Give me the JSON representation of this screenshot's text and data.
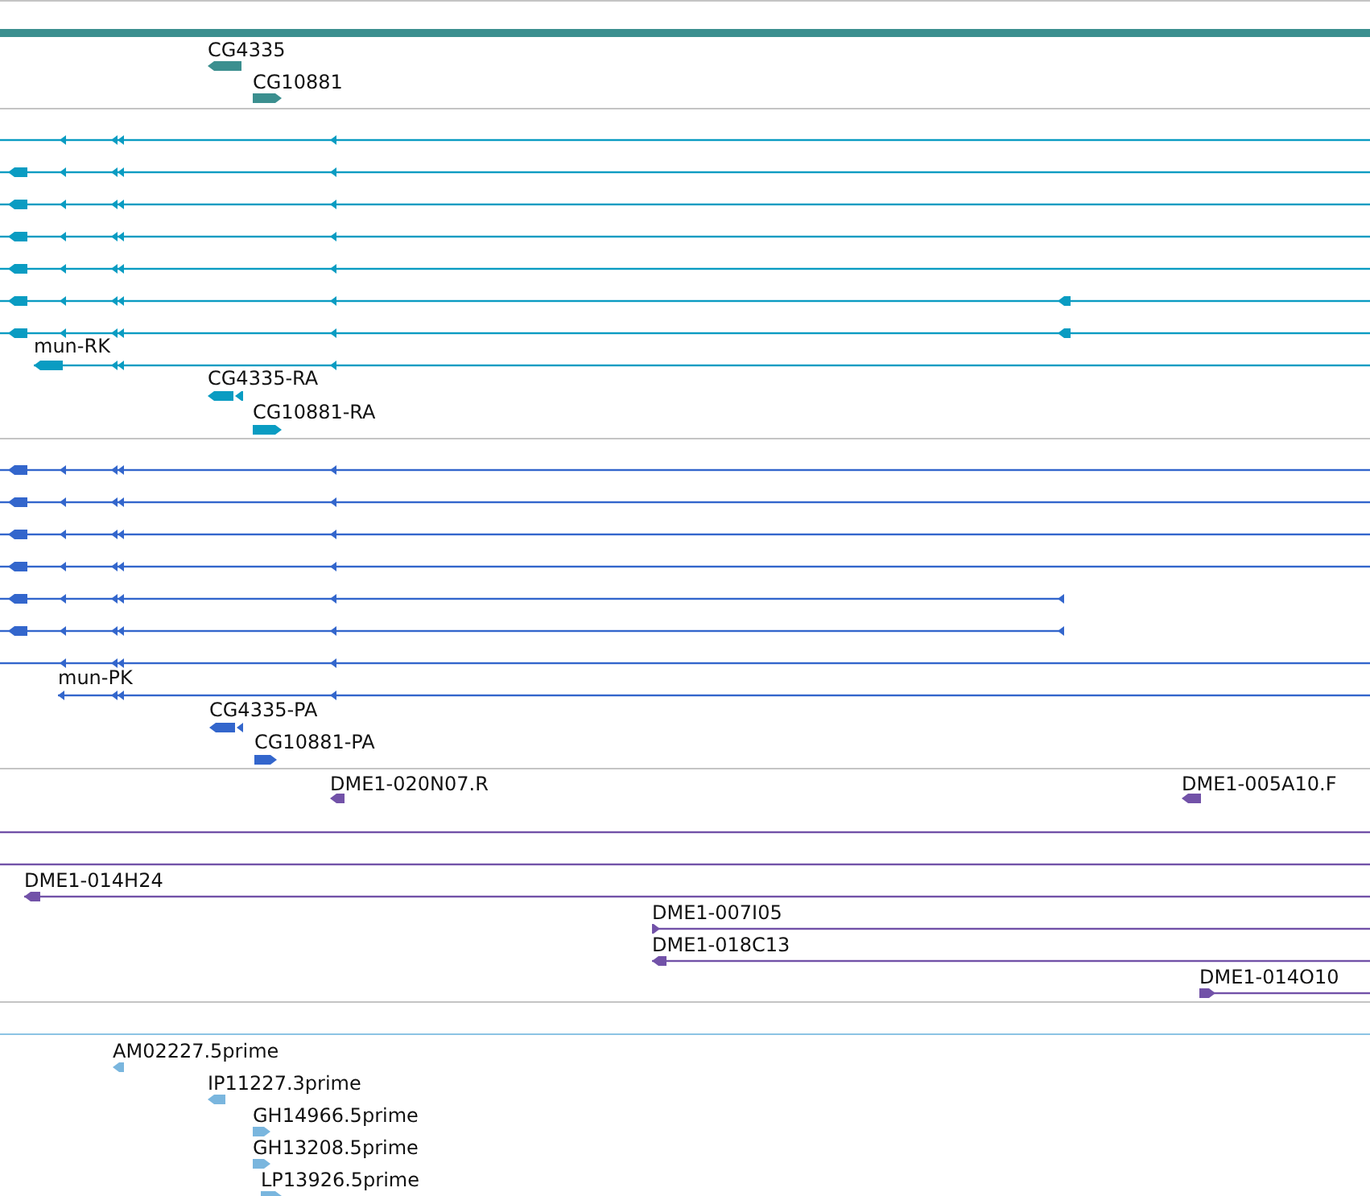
{
  "tracks": [
    {
      "kind": "gene",
      "color": "#3b8f8f",
      "features": [
        {
          "label": "CG4335",
          "kind": "reverse"
        },
        {
          "label": "CG10881",
          "kind": "forward"
        }
      ]
    },
    {
      "kind": "transcript",
      "color": "#0a9cc2",
      "features": [
        {
          "kind": "reverse"
        },
        {
          "kind": "reverse"
        },
        {
          "kind": "reverse"
        },
        {
          "kind": "reverse"
        },
        {
          "kind": "reverse"
        },
        {
          "kind": "reverse"
        },
        {
          "kind": "reverse"
        },
        {
          "label": "mun-RK",
          "kind": "reverse"
        },
        {
          "label": "CG4335-RA",
          "kind": "reverse"
        },
        {
          "label": "CG10881-RA",
          "kind": "forward"
        }
      ]
    },
    {
      "kind": "protein",
      "color": "#3366cc",
      "features": [
        {
          "kind": "reverse"
        },
        {
          "kind": "reverse"
        },
        {
          "kind": "reverse"
        },
        {
          "kind": "reverse"
        },
        {
          "kind": "reverse"
        },
        {
          "kind": "reverse"
        },
        {
          "kind": "reverse"
        },
        {
          "label": "mun-PK",
          "kind": "reverse"
        },
        {
          "label": "CG4335-PA",
          "kind": "reverse"
        },
        {
          "label": "CG10881-PA",
          "kind": "forward"
        }
      ]
    },
    {
      "kind": "clone",
      "color": "#7252a8",
      "features": [
        {
          "label": "DME1-020N07.R",
          "kind": "reverse"
        },
        {
          "label": "DME1-005A10.F",
          "kind": "reverse"
        },
        {
          "kind": "plain"
        },
        {
          "kind": "plain"
        },
        {
          "label": "DME1-014H24",
          "kind": "reverse"
        },
        {
          "label": "DME1-007I05",
          "kind": "forward"
        },
        {
          "label": "DME1-018C13",
          "kind": "reverse"
        },
        {
          "label": "DME1-014O10",
          "kind": "forward"
        }
      ]
    },
    {
      "kind": "est",
      "color": "#7ab6de",
      "features": [
        {
          "label": "AM02227.5prime",
          "kind": "reverse"
        },
        {
          "label": "IP11227.3prime",
          "kind": "reverse"
        },
        {
          "label": "GH14966.5prime",
          "kind": "forward"
        },
        {
          "label": "GH13208.5prime",
          "kind": "forward"
        },
        {
          "label": "LP13926.5prime",
          "kind": "forward"
        }
      ]
    }
  ]
}
